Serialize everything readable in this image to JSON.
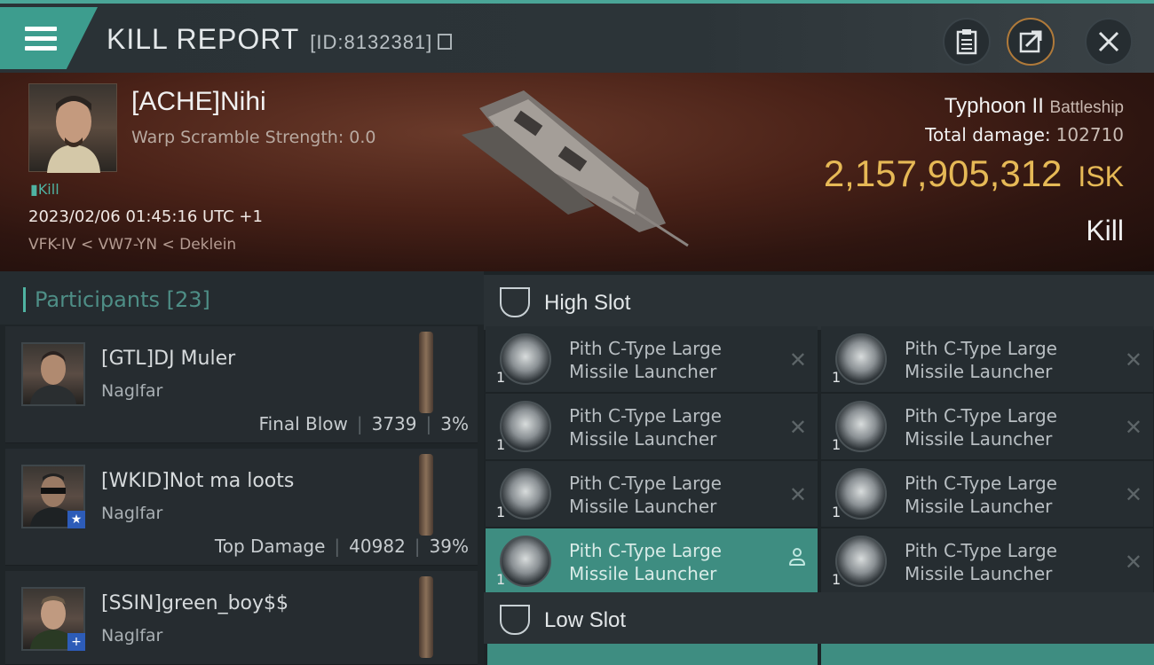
{
  "header": {
    "title": "KILL REPORT",
    "report_id": "[ID:8132381]",
    "buttons": [
      "clipboard",
      "share",
      "close"
    ]
  },
  "victim": {
    "name": "[ACHE]Nihi",
    "warp_scramble": "Warp Scramble Strength: 0.0",
    "status": "Kill",
    "datetime": "2023/02/06 01:45:16 UTC +1",
    "location": "VFK-IV < VW7-YN < Deklein",
    "ship_name": "Typhoon II",
    "ship_class": "Battleship",
    "total_damage_label": "Total damage:",
    "total_damage": "102710",
    "isk_value": "2,157,905,312",
    "isk_unit": "ISK",
    "result": "Kill"
  },
  "participants": {
    "title": "Participants",
    "count": "[23]",
    "rows": [
      {
        "name": "[GTL]DJ Muler",
        "ship": "Naglfar",
        "stat_label": "Final Blow",
        "damage": "3739",
        "percent": "3%",
        "badge": ""
      },
      {
        "name": "[WKID]Not ma loots",
        "ship": "Naglfar",
        "stat_label": "Top Damage",
        "damage": "40982",
        "percent": "39%",
        "badge": "★"
      },
      {
        "name": "[SSIN]green_boy$$",
        "ship": "Naglfar",
        "stat_label": "",
        "damage": "",
        "percent": "",
        "badge": "+"
      }
    ]
  },
  "slots": {
    "high": {
      "title": "High Slot",
      "modules": [
        {
          "name_line1": "Pith C-Type Large",
          "name_line2": "Missile Launcher",
          "qty": "1"
        },
        {
          "name_line1": "Pith C-Type Large",
          "name_line2": "Missile Launcher",
          "qty": "1"
        },
        {
          "name_line1": "Pith C-Type Large",
          "name_line2": "Missile Launcher",
          "qty": "1"
        },
        {
          "name_line1": "Pith C-Type Large",
          "name_line2": "Missile Launcher",
          "qty": "1"
        },
        {
          "name_line1": "Pith C-Type Large",
          "name_line2": "Missile Launcher",
          "qty": "1"
        },
        {
          "name_line1": "Pith C-Type Large",
          "name_line2": "Missile Launcher",
          "qty": "1"
        },
        {
          "name_line1": "Pith C-Type Large",
          "name_line2": "Missile Launcher",
          "qty": "1"
        },
        {
          "name_line1": "Pith C-Type Large",
          "name_line2": "Missile Launcher",
          "qty": "1"
        }
      ]
    },
    "low": {
      "title": "Low Slot"
    }
  },
  "colors": {
    "accent": "#3e8d81",
    "isk": "#e6b956",
    "teal_text": "#4fb3a2"
  }
}
